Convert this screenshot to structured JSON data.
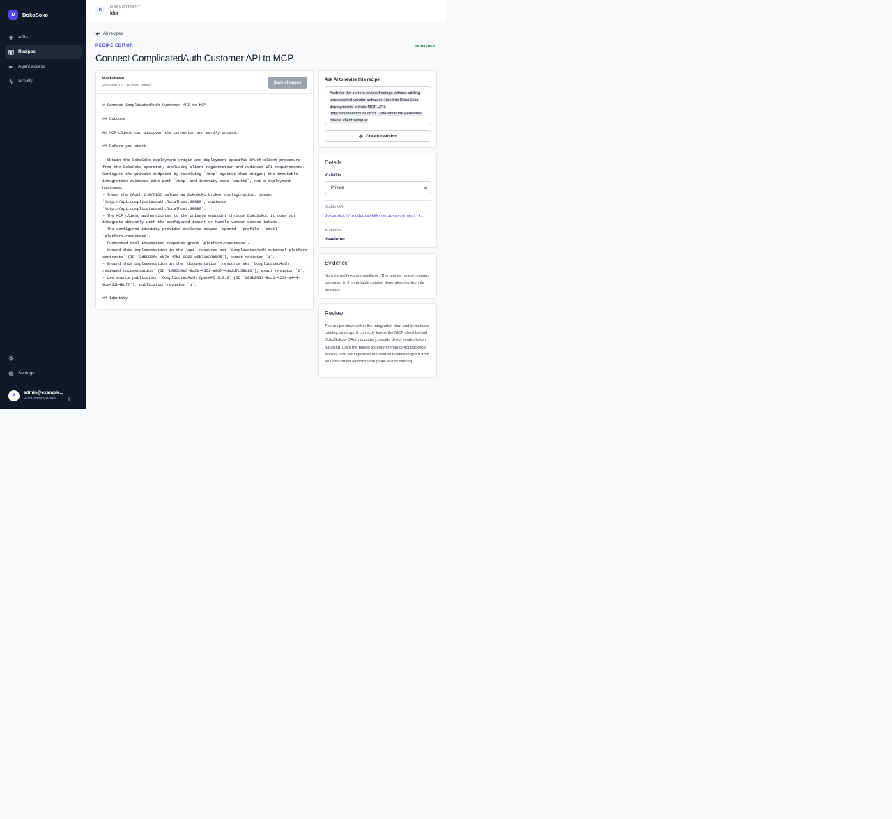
{
  "app": {
    "name": "DokoSoko",
    "logo_letter": "D"
  },
  "sidebar": {
    "items": [
      {
        "label": "APIs",
        "icon": "sparkles-icon"
      },
      {
        "label": "Recipes",
        "icon": "book-icon",
        "active": true
      },
      {
        "label": "Agent access",
        "icon": "broadcast-icon"
      },
      {
        "label": "Activity",
        "icon": "activity-icon"
      }
    ],
    "settings_label": "Settings",
    "user": {
      "initial": "A",
      "email": "admin@example...",
      "role": "Root administrator"
    }
  },
  "topbar": {
    "badge": "K",
    "label": "DEPLOYMENT",
    "name": "kkk"
  },
  "main": {
    "back_label": "All recipes",
    "eyebrow": "RECIPE EDITOR",
    "status": "Published",
    "title": "Connect ComplicatedAuth Customer API to MCP"
  },
  "editor": {
    "title": "Markdown",
    "revision": "Revision 15 · Human edited",
    "save_label": "Save changes",
    "content": "# Connect ComplicatedAuth Customer API to MCP\n\n## Outcome\n\nAn MCP client can discover the connector and verify access.\n\n## Before you start\n\n- Obtain the DokoSoko deployment origin and deployment-specific OAuth client procedure from the DokoSoko operator, including client registration and redirect-URI requirements. Configure the private endpoint by resolving `/mcp` against that origin; the immutable integration evidence pins path `/mcp` and identity mode `oauth2`, not a deployment hostname.\n- Treat the OAuth 2.0/OIDC values as DokoSoko broker configuration: issuer `http://api.complicatedauth.localhost:38080`, audience `http://api.complicatedauth.localhost:38080`.\n- The MCP client authenticates to the private endpoint through DokoSoko; it does not integrate directly with the configured issuer or handle vendor access tokens.\n- The configured identity provider declares scopes `openid` `profile` `email` `platform.readiness`.\n- Protected tool invocation requires grant `platform.readiness`.\n- Ground this implementation in the `api` resource set `ComplicatedAuth external-platform contracts` (ID `3d5089fc-ab7c-47b1-9863-e8b71d39b505`), exact revision `1`.\n- Ground this implementation in the `documentation` resource set `ComplicatedAuth reviewed documentation` (ID `b09550e6-9a2b-4561-a967-4da2dfc58e10`), exact revision `2`.\n- Use source publication `ComplicatedAuth OpenAPI 3.0.3` (ID `293b8033-9dc1-4173-a444-9ce431b48cf7`), publication revision `1`.\n\n## Identity"
  },
  "ai": {
    "label": "Ask AI to revise this recipe",
    "prompt": "Address the current review findings without adding unsupported vendor behavior. Use this DokoSoko deployment's private MCP URL `http://localhost:8080/mcp`, reference the generated private client setup at",
    "button_label": "Create revision"
  },
  "details": {
    "title": "Details",
    "visibility_label": "Visibility",
    "visibility_value": "Private",
    "stable_uri_label": "Stable URI",
    "stable_uri": "dokosoko://products/kkk/recipes/connect-k…",
    "audience_label": "Audience",
    "audience_value": "developer"
  },
  "evidence": {
    "title": "Evidence",
    "text": "No external links are available. This private recipe remains grounded in 9 immutable catalog dependencies from its analysis."
  },
  "review": {
    "title": "Review",
    "text": "The recipe stays within the integration plan and immutable catalog bindings. It correctly keeps the MCP client behind DokoSoko's OAuth boundary, avoids direct vendor-token handling, uses the bound tool rather than direct backend access, and distinguishes the shared readiness grant from an unrecorded authorization-point-to-tool binding."
  },
  "colors": {
    "sidebar_bg": "#111827",
    "accent": "#4f46e5",
    "published": "#15803d"
  }
}
